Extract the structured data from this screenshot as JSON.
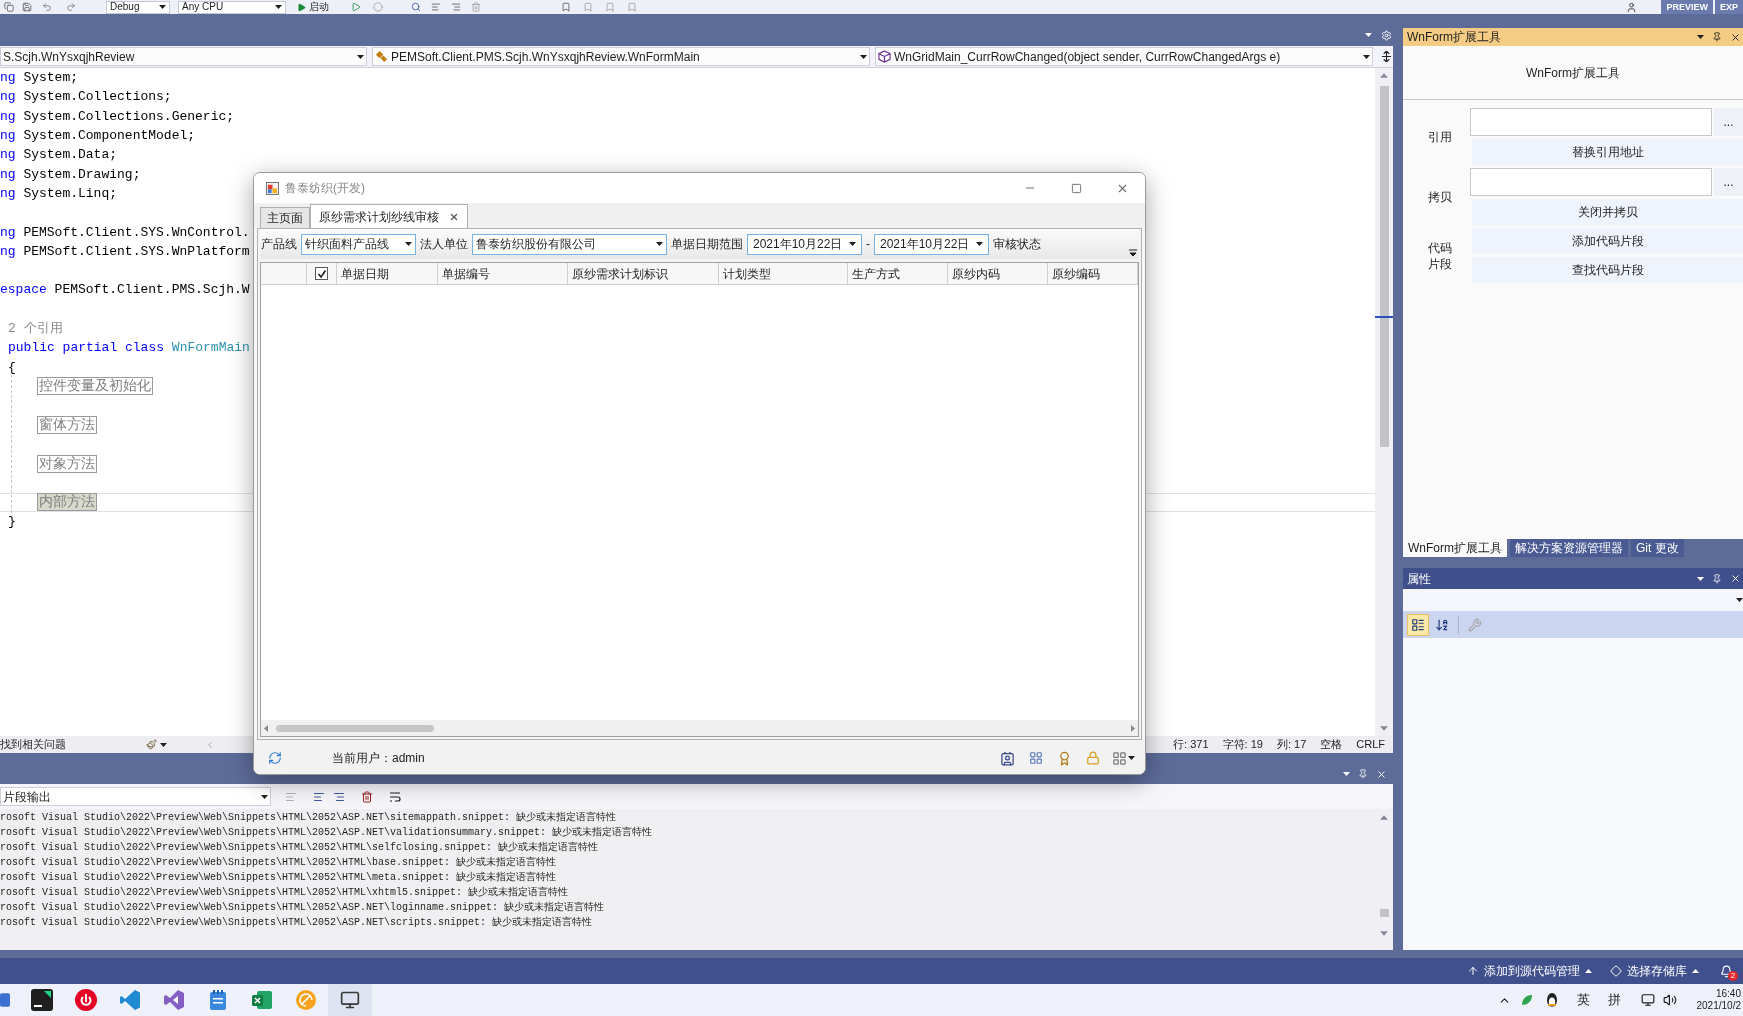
{
  "toolbar": {
    "configuration": "Debug",
    "platform": "Any CPU",
    "run": "启动",
    "badge": [
      "PREVIEW",
      "EXP"
    ]
  },
  "navigation_bar": [
    {
      "kind": "project",
      "text": "S.Scjh.WnYsxqjhReview"
    },
    {
      "kind": "class",
      "text": "PEMSoft.Client.PMS.Scjh.WnYsxqjhReview.WnFormMain"
    },
    {
      "kind": "method",
      "text": "WnGridMain_CurrRowChanged(object sender, CurrRowChangedArgs e)"
    }
  ],
  "editor": {
    "lines": [
      {
        "kind": "code",
        "tokens": [
          {
            "kind": "keyword",
            "text": "ng"
          },
          {
            "kind": "plain",
            "text": " System;"
          }
        ]
      },
      {
        "kind": "code",
        "tokens": [
          {
            "kind": "keyword",
            "text": "ng"
          },
          {
            "kind": "plain",
            "text": " System.Collections;"
          }
        ]
      },
      {
        "kind": "code",
        "tokens": [
          {
            "kind": "keyword",
            "text": "ng"
          },
          {
            "kind": "plain",
            "text": " System.Collections.Generic;"
          }
        ]
      },
      {
        "kind": "code",
        "tokens": [
          {
            "kind": "keyword",
            "text": "ng"
          },
          {
            "kind": "plain",
            "text": " System.ComponentModel;"
          }
        ]
      },
      {
        "kind": "code",
        "tokens": [
          {
            "kind": "keyword",
            "text": "ng"
          },
          {
            "kind": "plain",
            "text": " System.Data;"
          }
        ]
      },
      {
        "kind": "code",
        "tokens": [
          {
            "kind": "keyword",
            "text": "ng"
          },
          {
            "kind": "plain",
            "text": " System.Drawing;"
          }
        ]
      },
      {
        "kind": "code",
        "tokens": [
          {
            "kind": "keyword",
            "text": "ng"
          },
          {
            "kind": "plain",
            "text": " System.Linq;"
          }
        ]
      },
      {
        "kind": "blank"
      },
      {
        "kind": "code",
        "tokens": [
          {
            "kind": "keyword",
            "text": "ng"
          },
          {
            "kind": "plain",
            "text": " PEMSoft.Client.SYS.WnControl."
          }
        ]
      },
      {
        "kind": "code",
        "tokens": [
          {
            "kind": "keyword",
            "text": "ng"
          },
          {
            "kind": "plain",
            "text": " PEMSoft.Client.SYS.WnPlatform"
          }
        ]
      },
      {
        "kind": "blank"
      },
      {
        "kind": "code",
        "tokens": [
          {
            "kind": "keyword",
            "text": "espace"
          },
          {
            "kind": "plain",
            "text": " PEMSoft.Client.PMS.Scjh.W"
          }
        ]
      },
      {
        "kind": "blank"
      },
      {
        "kind": "codelens",
        "text": "2 个引用"
      },
      {
        "kind": "code",
        "indent": true,
        "tokens": [
          {
            "kind": "keyword",
            "text": "public partial class"
          },
          {
            "kind": "type",
            "text": " WnFormMain"
          }
        ]
      },
      {
        "kind": "code",
        "indent": true,
        "tokens": [
          {
            "kind": "plain",
            "text": "{"
          }
        ]
      },
      {
        "kind": "region",
        "text": "控件变量及初始化",
        "current": false
      },
      {
        "kind": "blank"
      },
      {
        "kind": "region",
        "text": "窗体方法",
        "current": false
      },
      {
        "kind": "blank"
      },
      {
        "kind": "region",
        "text": "对象方法",
        "current": false
      },
      {
        "kind": "blank"
      },
      {
        "kind": "region",
        "text": "内部方法",
        "current": true
      },
      {
        "kind": "code",
        "indent": true,
        "tokens": [
          {
            "kind": "plain",
            "text": "}"
          }
        ]
      }
    ]
  },
  "editor_status": {
    "message": "找到相关问题",
    "position": [
      "行: 371",
      "字符: 19",
      "列: 17",
      "空格",
      "CRLF"
    ]
  },
  "output": {
    "source": "片段输出",
    "lines": [
      "rosoft Visual Studio\\2022\\Preview\\Web\\Snippets\\HTML\\2052\\ASP.NET\\sitemappath.snippet: 缺少或未指定语言特性",
      "rosoft Visual Studio\\2022\\Preview\\Web\\Snippets\\HTML\\2052\\ASP.NET\\validationsummary.snippet: 缺少或未指定语言特性",
      "rosoft Visual Studio\\2022\\Preview\\Web\\Snippets\\HTML\\2052\\HTML\\selfclosing.snippet: 缺少或未指定语言特性",
      "rosoft Visual Studio\\2022\\Preview\\Web\\Snippets\\HTML\\2052\\HTML\\base.snippet: 缺少或未指定语言特性",
      "rosoft Visual Studio\\2022\\Preview\\Web\\Snippets\\HTML\\2052\\HTML\\meta.snippet: 缺少或未指定语言特性",
      "rosoft Visual Studio\\2022\\Preview\\Web\\Snippets\\HTML\\2052\\HTML\\xhtml5.snippet: 缺少或未指定语言特性",
      "rosoft Visual Studio\\2022\\Preview\\Web\\Snippets\\HTML\\2052\\ASP.NET\\loginname.snippet: 缺少或未指定语言特性",
      "rosoft Visual Studio\\2022\\Preview\\Web\\Snippets\\HTML\\2052\\ASP.NET\\scripts.snippet: 缺少或未指定语言特性"
    ]
  },
  "side_panel": {
    "title": "WnForm扩展工具",
    "heading": "WnForm扩展工具",
    "groups": [
      {
        "kind": "browse",
        "label": "引用",
        "browse": "...",
        "buttons": [
          "替换引用地址"
        ]
      },
      {
        "kind": "browse",
        "label": "拷贝",
        "browse": "...",
        "buttons": [
          "关闭并拷贝"
        ]
      },
      {
        "kind": "actions",
        "label": "代码片段",
        "buttons": [
          "添加代码片段",
          "查找代码片段"
        ]
      }
    ],
    "tabs": [
      {
        "label": "WnForm扩展工具",
        "selected": true
      },
      {
        "label": "解决方案资源管理器",
        "selected": false
      },
      {
        "label": "Git 更改",
        "selected": false
      }
    ]
  },
  "properties": {
    "title": "属性",
    "tools": [
      {
        "kind": "categorized",
        "selected": true,
        "disabled": false
      },
      {
        "kind": "alphabetical",
        "selected": false,
        "disabled": false
      },
      {
        "kind": "property_pages",
        "selected": false,
        "disabled": true
      }
    ]
  },
  "status_bar": {
    "actions": [
      {
        "kind": "source_control",
        "text": "添加到源代码管理"
      },
      {
        "kind": "repository",
        "text": "选择存储库"
      }
    ],
    "notification_count": "2"
  },
  "taskbar": {
    "apps": [
      {
        "kind": "window",
        "selected": false
      },
      {
        "kind": "database",
        "selected": false
      },
      {
        "kind": "music",
        "selected": false
      },
      {
        "kind": "code",
        "selected": false
      },
      {
        "kind": "ide",
        "selected": false
      },
      {
        "kind": "notepad",
        "selected": false
      },
      {
        "kind": "spreadsheet",
        "selected": false
      },
      {
        "kind": "swirl",
        "selected": false
      },
      {
        "kind": "remote",
        "selected": true
      }
    ],
    "tray": [
      "英",
      "拼"
    ],
    "time": "16:40",
    "date": "2021/10/2"
  },
  "dialog": {
    "title": "鲁泰纺织(开发)",
    "tabs": [
      {
        "label": "主页面",
        "selected": false,
        "closable": false
      },
      {
        "label": "原纱需求计划纱线审核",
        "selected": true,
        "closable": true
      }
    ],
    "filters": [
      {
        "kind": "label",
        "text": "产品线"
      },
      {
        "kind": "combo",
        "value": "针织面料产品线"
      },
      {
        "kind": "label",
        "text": "法人单位"
      },
      {
        "kind": "combo",
        "value": "鲁泰纺织股份有限公司"
      },
      {
        "kind": "label",
        "text": "单据日期范围"
      },
      {
        "kind": "date",
        "value": "2021年10月22日"
      },
      {
        "kind": "label",
        "text": "-"
      },
      {
        "kind": "date",
        "value": "2021年10月22日"
      },
      {
        "kind": "label",
        "text": "审核状态"
      }
    ],
    "grid": {
      "select_all": {
        "checked": true
      },
      "columns": [
        "单据日期",
        "单据编号",
        "原纱需求计划标识",
        "计划类型",
        "生产方式",
        "原纱内码",
        "原纱编码"
      ]
    },
    "status": {
      "user": "当前用户：admin"
    }
  }
}
